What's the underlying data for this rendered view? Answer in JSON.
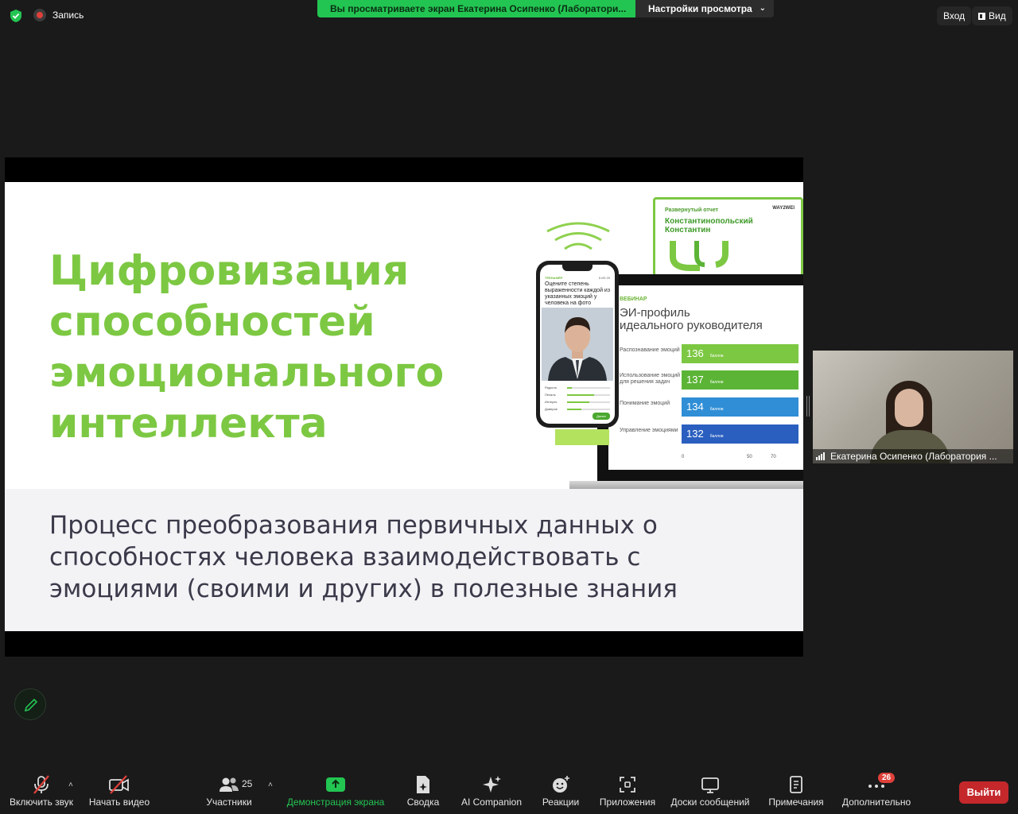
{
  "topbar": {
    "recording_label": "Запись",
    "share_banner": "Вы просматриваете экран Екатерина Осипенко (Лаборатори...",
    "view_settings": "Настройки просмотра",
    "exit_fullscreen": "Вход",
    "view": "Вид"
  },
  "slide": {
    "title_lines": [
      "Цифровизация",
      "способностей",
      "эмоционального",
      "интеллекта"
    ],
    "subtitle_lines": [
      "Процесс преобразования первичных данных о",
      "способностях человека взаимодействовать с",
      "эмоциями (своими и других) в полезные знания"
    ],
    "report": {
      "label": "Развернутый отчет",
      "name_1": "Константинопольский",
      "name_2": "Константин",
      "brand": "WAY2WEI"
    },
    "webinar": {
      "tag": "ВЕБИНАР",
      "title_1": "ЭИ-профиль",
      "title_2": "идеального руководителя",
      "bars": [
        {
          "label": "Распознавание эмоций",
          "value": "136",
          "unit": "баллов",
          "color": "#7dc843"
        },
        {
          "label": "Использование эмоций для решения задач",
          "value": "137",
          "unit": "баллов",
          "color": "#5cb436"
        },
        {
          "label": "Понимание эмоций",
          "value": "134",
          "unit": "баллов",
          "color": "#2f8ed6"
        },
        {
          "label": "Управление эмоциями",
          "value": "132",
          "unit": "баллов",
          "color": "#2a5fbf"
        }
      ],
      "axis": [
        "0",
        "50",
        "70"
      ]
    },
    "phone": {
      "tag": "ТРЕНАЖЁР",
      "count": "5 ИЗ 20",
      "question": "Оцените степень выраженности каждой из указанных эмоций у человека на фото",
      "sliders": [
        "Радость",
        "Печаль",
        "Интерес",
        "Доверие"
      ],
      "next": "Далее"
    }
  },
  "speaker": {
    "name": "Екатерина Осипенко (Лаборатория ..."
  },
  "toolbar": {
    "unmute": "Включить звук",
    "start_video": "Начать видео",
    "participants": "Участники",
    "participants_count": "25",
    "share_screen": "Демонстрация экрана",
    "summary": "Сводка",
    "ai_companion": "AI Companion",
    "reactions": "Реакции",
    "apps": "Приложения",
    "whiteboards": "Доски сообщений",
    "notes": "Примечания",
    "more": "Дополнительно",
    "more_badge": "26",
    "leave": "Выйти"
  }
}
